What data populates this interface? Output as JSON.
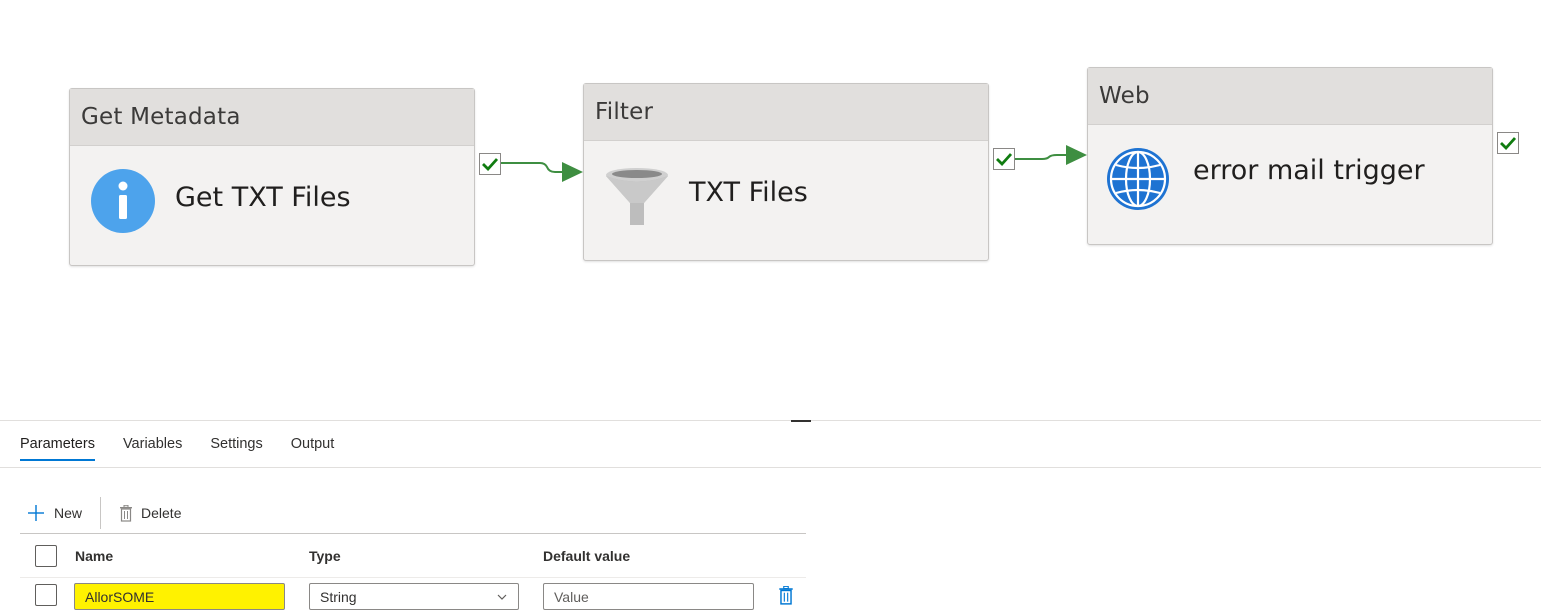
{
  "pipeline": {
    "activities": [
      {
        "type": "Get Metadata",
        "name": "Get TXT Files",
        "icon": "info-icon"
      },
      {
        "type": "Filter",
        "name": "TXT Files",
        "icon": "funnel-icon"
      },
      {
        "type": "Web",
        "name": "error mail trigger",
        "icon": "globe-icon"
      }
    ],
    "success_color": "#107c10",
    "connector_color": "#3e8e41"
  },
  "tabs": [
    {
      "label": "Parameters",
      "active": true
    },
    {
      "label": "Variables",
      "active": false
    },
    {
      "label": "Settings",
      "active": false
    },
    {
      "label": "Output",
      "active": false
    }
  ],
  "toolbar": {
    "new_label": "New",
    "new_icon": "plus-icon",
    "delete_label": "Delete",
    "delete_icon": "trash-icon"
  },
  "table": {
    "headers": {
      "name": "Name",
      "type": "Type",
      "default": "Default value"
    },
    "rows": [
      {
        "name": "AllorSOME",
        "type": "String",
        "default_placeholder": "Value"
      }
    ]
  },
  "colors": {
    "accent": "#0078d4",
    "highlight": "#fff200",
    "delete_icon": "#0078d4"
  }
}
